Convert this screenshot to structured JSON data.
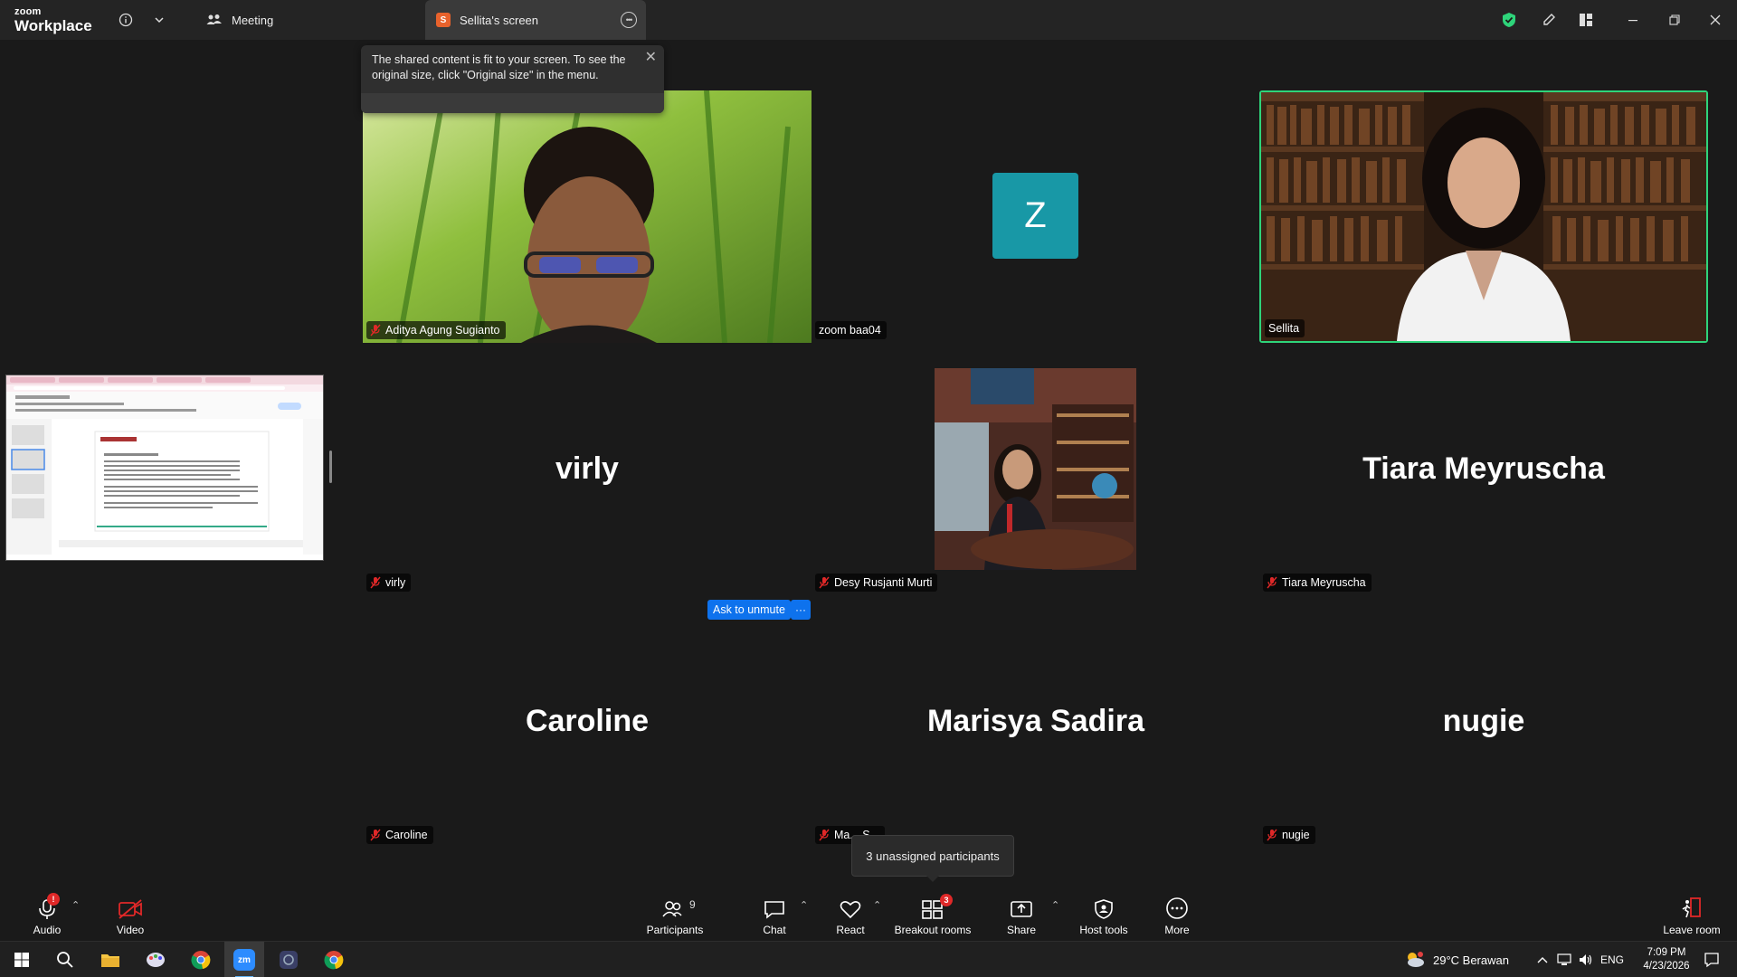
{
  "titlebar": {
    "logo_line1": "zoom",
    "logo_line2": "Workplace",
    "meeting_tab": "Meeting",
    "screen_tab": "Sellita's screen",
    "screen_tab_badge": "S"
  },
  "notice": {
    "text": "The shared content is fit to your screen. To see the original size, click \"Original size\" in the menu."
  },
  "tiles": [
    {
      "name": "Aditya Agung Sugianto",
      "muted": true,
      "video": true
    },
    {
      "name": "zoom baa04",
      "muted": false,
      "avatar_letter": "Z"
    },
    {
      "name": "Sellita",
      "muted": false,
      "video": true,
      "active": true
    },
    {
      "name": "virly",
      "muted": true,
      "display_name": "virly"
    },
    {
      "name": "Desy Rusjanti Murti",
      "muted": true,
      "video": true
    },
    {
      "name": "Tiara Meyruscha",
      "muted": true,
      "display_name": "Tiara Meyruscha"
    },
    {
      "name": "Caroline",
      "muted": true,
      "display_name": "Caroline"
    },
    {
      "name": "Ma... S...",
      "muted": true,
      "display_name": "Marisya Sadira"
    },
    {
      "name": "nugie",
      "muted": true,
      "display_name": "nugie"
    }
  ],
  "ask_unmute": "Ask to unmute",
  "ask_more": "···",
  "unassigned_tooltip": "3 unassigned participants",
  "toolbar": {
    "audio": "Audio",
    "video": "Video",
    "participants": "Participants",
    "participants_count": "9",
    "chat": "Chat",
    "react": "React",
    "breakout": "Breakout rooms",
    "breakout_badge": "3",
    "share": "Share",
    "host_tools": "Host tools",
    "more": "More",
    "leave": "Leave room",
    "audio_badge": "!"
  },
  "taskbar": {
    "weather": "29°C  Berawan",
    "lang": "ENG",
    "time": "7:09 PM",
    "date": "4/23/2026"
  },
  "colors": {
    "accent_blue": "#0e72ed",
    "active_speaker": "#2ed47a",
    "avatar_bg": "#1898a6",
    "alert_red": "#e02828"
  }
}
